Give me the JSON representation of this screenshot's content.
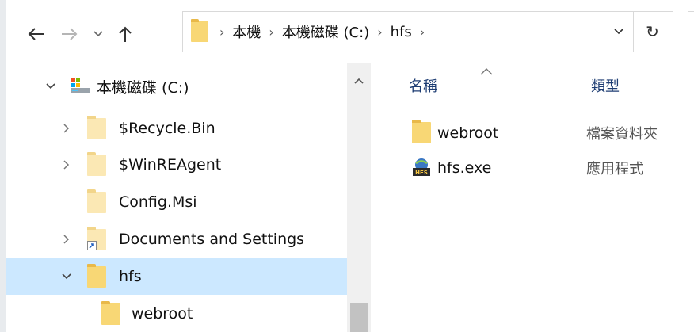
{
  "nav": {
    "back_icon": "arrow-left",
    "forward_icon": "arrow-right",
    "recent_icon": "chevron-down",
    "up_icon": "arrow-up"
  },
  "address": {
    "crumbs": [
      "本機",
      "本機磁碟 (C:)",
      "hfs"
    ],
    "separator": "›",
    "refresh_glyph": "↻"
  },
  "tree": {
    "items": [
      {
        "label": "本機磁碟 (C:)",
        "icon": "drive-icon",
        "expanded": true
      },
      {
        "label": "$Recycle.Bin",
        "icon": "folder-icon",
        "expanded": false
      },
      {
        "label": "$WinREAgent",
        "icon": "folder-icon",
        "expanded": false
      },
      {
        "label": "Config.Msi",
        "icon": "folder-icon"
      },
      {
        "label": "Documents and Settings",
        "icon": "shortcut-folder-icon",
        "expanded": false
      },
      {
        "label": "hfs",
        "icon": "folder-icon",
        "expanded": true,
        "selected": true
      },
      {
        "label": "webroot",
        "icon": "folder-icon"
      }
    ]
  },
  "list": {
    "columns": [
      "名稱",
      "類型"
    ],
    "files": [
      {
        "name": "webroot",
        "type": "檔案資料夾",
        "icon": "folder-icon"
      },
      {
        "name": "hfs.exe",
        "type": "應用程式",
        "icon": "hfs-app-icon"
      }
    ]
  },
  "colors": {
    "selection": "#cce8ff",
    "folder": "#f8d775",
    "header_text": "#1e3d73"
  }
}
